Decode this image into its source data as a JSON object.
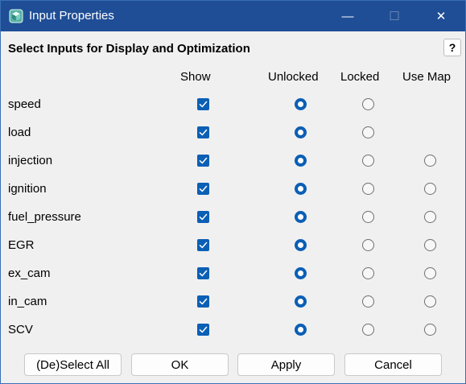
{
  "window": {
    "title": "Input Properties"
  },
  "titlebar": {
    "minimize_glyph": "—",
    "maximize_glyph": "☐",
    "close_glyph": "✕"
  },
  "heading": "Select Inputs for Display and Optimization",
  "help_label": "?",
  "columns": {
    "show": "Show",
    "unlocked": "Unlocked",
    "locked": "Locked",
    "use_map": "Use Map"
  },
  "rows": [
    {
      "name": "speed",
      "show": true,
      "selection": "unlocked",
      "has_use_map": false
    },
    {
      "name": "load",
      "show": true,
      "selection": "unlocked",
      "has_use_map": false
    },
    {
      "name": "injection",
      "show": true,
      "selection": "unlocked",
      "has_use_map": true
    },
    {
      "name": "ignition",
      "show": true,
      "selection": "unlocked",
      "has_use_map": true
    },
    {
      "name": "fuel_pressure",
      "show": true,
      "selection": "unlocked",
      "has_use_map": true
    },
    {
      "name": "EGR",
      "show": true,
      "selection": "unlocked",
      "has_use_map": true
    },
    {
      "name": "ex_cam",
      "show": true,
      "selection": "unlocked",
      "has_use_map": true
    },
    {
      "name": "in_cam",
      "show": true,
      "selection": "unlocked",
      "has_use_map": true
    },
    {
      "name": "SCV",
      "show": true,
      "selection": "unlocked",
      "has_use_map": true
    }
  ],
  "buttons": {
    "select_all": "(De)Select All",
    "ok": "OK",
    "apply": "Apply",
    "cancel": "Cancel"
  },
  "colors": {
    "titlebar": "#1f4e96",
    "accent": "#0b5fb5",
    "dialog_bg": "#f0f0f0"
  },
  "icons": {
    "app": "app-cube-icon",
    "checkbox": "checkmark-icon"
  }
}
